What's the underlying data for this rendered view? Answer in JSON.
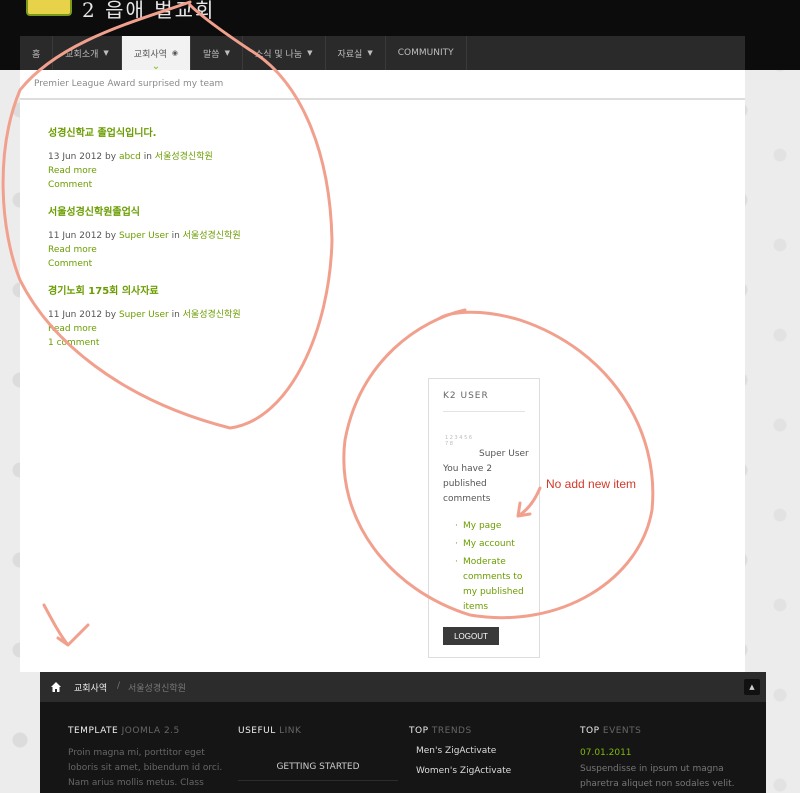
{
  "header": {
    "logo_text": "2 읍애 벌교회",
    "nav": [
      {
        "label": "홈",
        "chevron": false,
        "active": false
      },
      {
        "label": "교회소개",
        "chevron": true,
        "active": false
      },
      {
        "label": "교회사역",
        "chevron": true,
        "active": true
      },
      {
        "label": "말씀",
        "chevron": true,
        "active": false
      },
      {
        "label": "소식 및 나눔",
        "chevron": true,
        "active": false
      },
      {
        "label": "자료실",
        "chevron": true,
        "active": false
      },
      {
        "label": "COMMUNITY",
        "chevron": false,
        "active": false
      }
    ],
    "ticker": "Premier League Award surprised my team"
  },
  "items": [
    {
      "title": "성경신학교 졸업식입니다.",
      "date": "13 Jun 2012",
      "by": "by",
      "author": "abcd",
      "in": "in",
      "category": "서울성경신학원",
      "read_more": "Read more",
      "comment": "Comment"
    },
    {
      "title": "서울성경신학원졸업식",
      "date": "11 Jun 2012",
      "by": "by",
      "author": "Super User",
      "in": "in",
      "category": "서울성경신학원",
      "read_more": "Read more",
      "comment": "Comment"
    },
    {
      "title": "경기노회 175회 의사자료",
      "date": "11 Jun 2012",
      "by": "by",
      "author": "Super User",
      "in": "in",
      "category": "서울성경신학원",
      "read_more": "Read more",
      "comment": "1 comment"
    }
  ],
  "k2user": {
    "title": "K2 USER",
    "avatar_text": "1 2 3 4 5 6 7 8",
    "message": "Super User You have 2 published comments",
    "menu": [
      "My page",
      "My account",
      "Moderate comments to my published items"
    ],
    "logout": "LOGOUT"
  },
  "annotation": "No add new item",
  "footer_bar": {
    "current": "교회사역",
    "separator": "/",
    "crumb": "서울성경신학원",
    "top_icon": "▲"
  },
  "footer": {
    "col1": {
      "head": "TEMPLATE",
      "head_dim": "JOOMLA 2.5",
      "text": "Proin magna mi, porttitor eget loboris sit amet, bibendum id orci. Nam arius mollis metus. Class"
    },
    "col2": {
      "head": "USEFUL",
      "head_dim": "LINK",
      "item": "GETTING STARTED"
    },
    "col3": {
      "head": "TOP",
      "head_dim": "TRENDS",
      "items": [
        "Men's ZigActivate",
        "Women's ZigActivate"
      ]
    },
    "col4": {
      "head": "TOP",
      "head_dim": "EVENTS",
      "date": "07.01.2011",
      "text": "Suspendisse in ipsum ut magna pharetra aliquet non sodales velit."
    }
  },
  "colors": {
    "accent": "#6b9d00",
    "sketch": "#f2a08e"
  }
}
